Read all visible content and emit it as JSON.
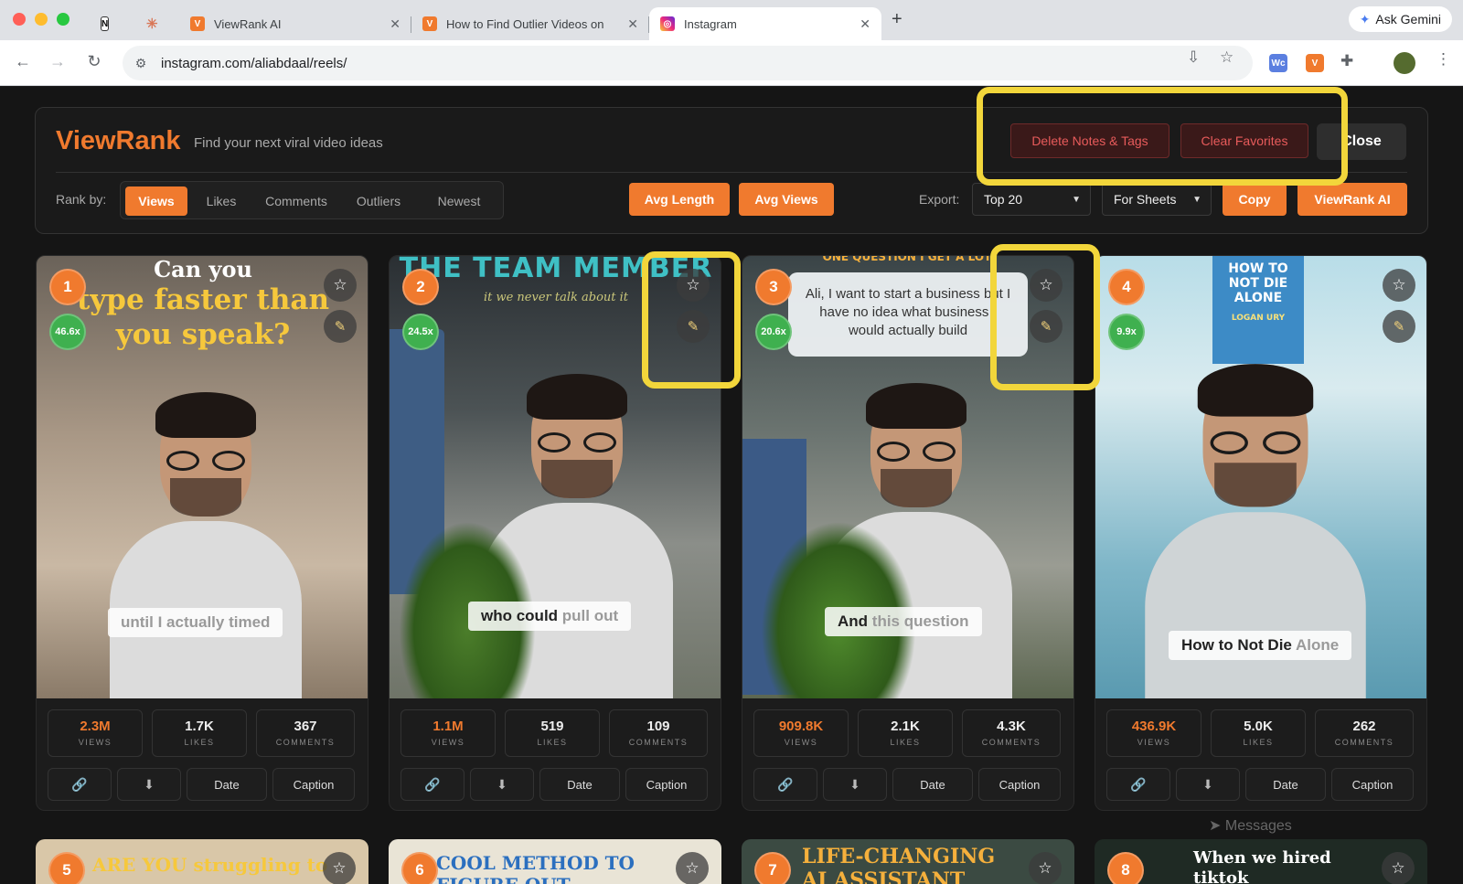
{
  "browser": {
    "tabs": [
      {
        "title": "",
        "favicon": "N"
      },
      {
        "title": "",
        "favicon": "✳"
      },
      {
        "title": "ViewRank AI",
        "favicon": "V"
      },
      {
        "title": "How to Find Outlier Videos on",
        "favicon": "V"
      },
      {
        "title": "Instagram",
        "favicon": "◎"
      }
    ],
    "ask_gemini": "Ask Gemini",
    "url": "instagram.com/aliabdaal/reels/"
  },
  "viewrank": {
    "brand": "ViewRank",
    "tagline": "Find your next viral video ideas",
    "delete_notes": "Delete Notes & Tags",
    "clear_favorites": "Clear Favorites",
    "close": "Close",
    "rank_label": "Rank by:",
    "rank_options": [
      "Views",
      "Likes",
      "Comments",
      "Outliers",
      "Newest"
    ],
    "rank_selected": "Views",
    "avg_length": "Avg Length",
    "avg_views": "Avg Views",
    "export_label": "Export:",
    "export_count": "Top 20",
    "export_format": "For Sheets",
    "copy": "Copy",
    "ai": "ViewRank AI"
  },
  "cards": [
    {
      "rank": "1",
      "outlier": "46.6x",
      "headline1": "Can you",
      "headline2": "type faster than",
      "headline3": "you speak?",
      "caption_a": "until I actually timed",
      "caption_b": "",
      "views": "2.3M",
      "likes": "1.7K",
      "comments": "367"
    },
    {
      "rank": "2",
      "outlier": "24.5x",
      "headline1": "THE TEAM MEMBER",
      "headline2": "it we never talk about it",
      "headline3": "",
      "caption_a": "who could ",
      "caption_b": "pull out",
      "views": "1.1M",
      "likes": "519",
      "comments": "109"
    },
    {
      "rank": "3",
      "outlier": "20.6x",
      "headline1": "ONE QUESTION I GET A LOT:",
      "headline2": "Ali, I want to start a business but I have no idea what business I would actually build",
      "headline3": "",
      "caption_a": "And ",
      "caption_b": "this question",
      "views": "909.8K",
      "likes": "2.1K",
      "comments": "4.3K"
    },
    {
      "rank": "4",
      "outlier": "9.9x",
      "headline1": "HOW TO NOT DIE ALONE",
      "headline2": "LOGAN URY",
      "headline3": "",
      "caption_a": "How to Not Die ",
      "caption_b": "Alone",
      "views": "436.9K",
      "likes": "5.0K",
      "comments": "262"
    }
  ],
  "stat_labels": {
    "views": "VIEWS",
    "likes": "LIKES",
    "comments": "COMMENTS"
  },
  "action_labels": {
    "date": "Date",
    "caption": "Caption"
  },
  "peeks": [
    {
      "rank": "5",
      "text": "ARE YOU struggling to"
    },
    {
      "rank": "6",
      "text": "COOL METHOD TO FIGURE OUT"
    },
    {
      "rank": "7",
      "text": "LIFE-CHANGING AI ASSISTANT"
    },
    {
      "rank": "8",
      "text": "When we hired tiktok"
    }
  ],
  "background": {
    "messages": "Messages"
  },
  "colors": {
    "accent": "#f07a2e",
    "outlier_badge": "#3fb04f",
    "danger": "#e85b5b",
    "highlight": "#f2d63b"
  }
}
